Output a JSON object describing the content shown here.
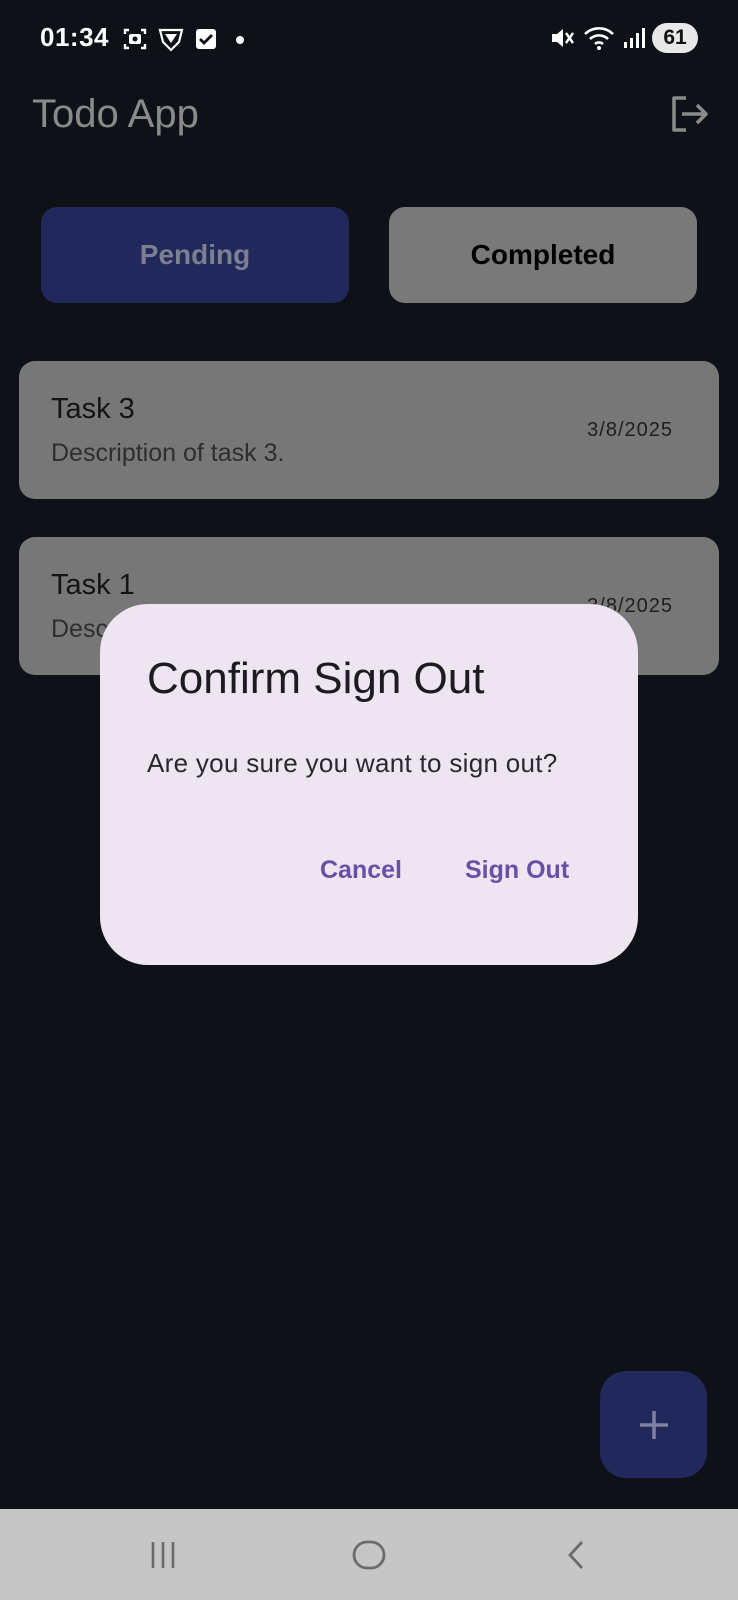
{
  "status_bar": {
    "time": "01:34",
    "battery": "61"
  },
  "app_bar": {
    "title": "Todo App"
  },
  "tabs": [
    {
      "label": "Pending",
      "selected": true
    },
    {
      "label": "Completed",
      "selected": false
    }
  ],
  "tasks": [
    {
      "title": "Task 3",
      "description": "Description of task 3.",
      "date": "3/8/2025"
    },
    {
      "title": "Task 1",
      "description": "Description of task 1.",
      "date": "3/8/2025"
    }
  ],
  "dialog": {
    "title": "Confirm Sign Out",
    "message": "Are you sure you want to sign out?",
    "cancel_label": "Cancel",
    "confirm_label": "Sign Out"
  },
  "fab": {
    "icon": "plus-icon"
  },
  "nav_bar": {
    "icons": [
      "recent-apps-icon",
      "home-icon",
      "back-icon"
    ]
  },
  "colors": {
    "background": "#0e1117",
    "accent_tab": "#20285c",
    "dialog_bg": "#ede5f1",
    "dialog_button": "#6a4fa5"
  }
}
